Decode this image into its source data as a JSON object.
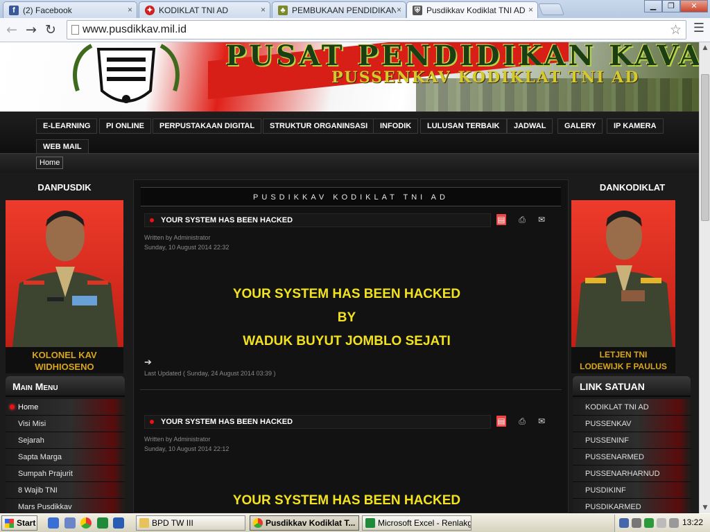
{
  "browser": {
    "tabs": [
      {
        "title": "(2) Facebook",
        "icon": "facebook-icon",
        "active": false
      },
      {
        "title": "KODIKLAT TNI AD",
        "icon": "kodiklat-icon",
        "active": false
      },
      {
        "title": "PEMBUKAAN PENDIDIKAN DI",
        "icon": "emblem-icon",
        "active": false
      },
      {
        "title": "Pusdikkav Kodiklat TNI AD",
        "icon": "shield-icon",
        "active": true
      }
    ],
    "close_glyph": "×",
    "url": "www.pusdikkav.mil.id"
  },
  "site": {
    "banner_title": "PUSAT PENDIDIKAN KAVAL",
    "banner_subtitle": "PUSSENKAV KODIKLAT TNI AD",
    "nav": [
      "E-LEARNING",
      "PI ONLINE",
      "PERPUSTAKAAN DIGITAL",
      "STRUKTUR ORGANINSASI",
      "INFODIK",
      "LULUSAN TERBAIK",
      "JADWAL",
      "GALERY",
      "IP KAMERA",
      "WEB MAIL"
    ],
    "breadcrumb": "Home",
    "left": {
      "heading": "DANPUSDIK",
      "caption_line1": "KOLONEL KAV",
      "caption_line2": "WIDHIOSENO",
      "menu_title": "Main Menu",
      "menu": [
        "Home",
        "Visi Misi",
        "Sejarah",
        "Sapta Marga",
        "Sumpah Prajurit",
        "8 Wajib TNI",
        "Mars Pusdikkav"
      ]
    },
    "right": {
      "heading": "DANKODIKLAT",
      "caption_line1": "LETJEN TNI",
      "caption_line2": "LODEWIJK F PAULUS",
      "link_title": "LINK SATUAN",
      "links": [
        "KODIKLAT TNI AD",
        "PUSSENKAV",
        "PUSSENINF",
        "PUSSENARMED",
        "PUSSENARHARNUD",
        "PUSDIKINF",
        "PUSDIKARMED"
      ]
    },
    "content": {
      "site_title": "PUSDIKKAV KODIKLAT TNI AD",
      "articles": [
        {
          "title": "YOUR SYSTEM HAS BEEN HACKED",
          "author": "Written by  Administrator",
          "date": "Sunday, 10 August 2014 22:32",
          "line1": "YOUR SYSTEM HAS BEEN HACKED",
          "line2": "BY",
          "line3": "WADUK BUYUT JOMBLO SEJATI",
          "arrow": "➔",
          "updated": "Last Updated ( Sunday, 24 August 2014 03:39 )"
        },
        {
          "title": "YOUR SYSTEM HAS BEEN HACKED",
          "author": "Written by  Administrator",
          "date": "Sunday, 10 August 2014 22:12",
          "line1": "YOUR SYSTEM HAS BEEN HACKED"
        }
      ]
    }
  },
  "taskbar": {
    "start": "Start",
    "tasks": [
      {
        "label": "BPD TW III",
        "icon": "folder-icon"
      },
      {
        "label": "Pusdikkav Kodiklat T...",
        "icon": "chrome-icon",
        "active": true
      },
      {
        "label": "Microsoft Excel - Renlakg...",
        "icon": "excel-icon"
      }
    ],
    "clock": "13:22"
  },
  "colors": {
    "accent_yellow": "#f2e220",
    "caption_gold": "#d9a51c",
    "menu_red": "#5a0c0c",
    "page_bg": "#1b1b1b"
  }
}
